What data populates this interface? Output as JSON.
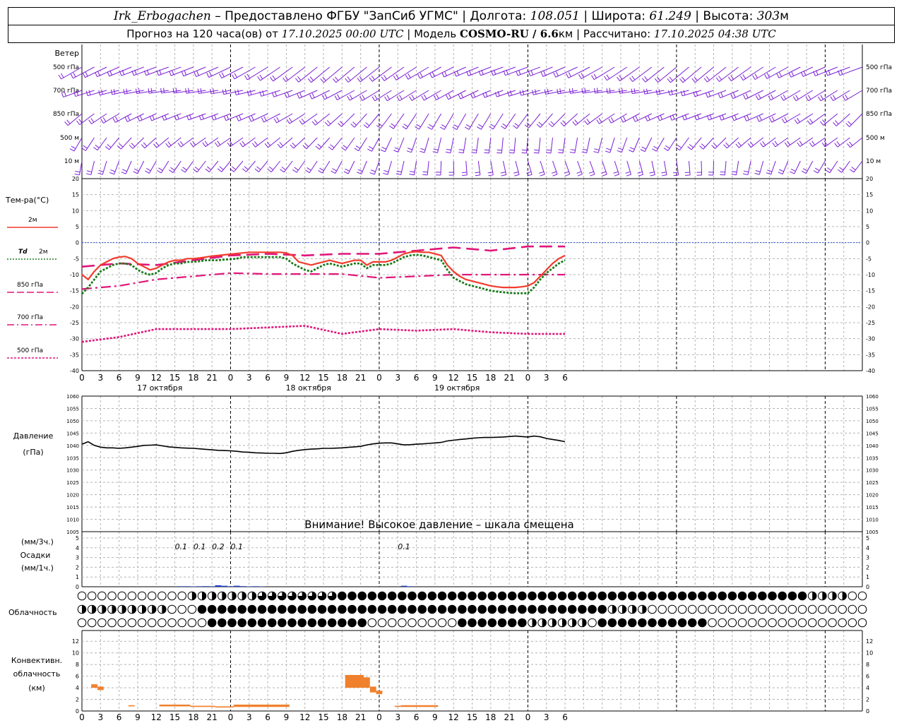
{
  "header": {
    "station": "Irk_Erbogachen",
    "provider": " – Предоставлено ФГБУ \"ЗапСиб УГМС\" | Долгота: ",
    "lon": "108.051",
    "lat_label": " | Широта: ",
    "lat": "61.249",
    "alt_label": " | Высота: ",
    "alt": "303",
    "alt_unit": "м",
    "forecast_label": "Прогноз на 120 часа(ов) от ",
    "forecast_time": "17.10.2025 00:00 UTC",
    "model_label": " | Модель ",
    "model": "COSMO-RU / 6.6",
    "model_unit": "км",
    "calc_label": " | Рассчитано: ",
    "calc_time": "17.10.2025 04:38 UTC"
  },
  "colors": {
    "wind": "#7b1fd6",
    "t2m": "#f03c2c",
    "td2m": "#1a7a1a",
    "t850": "#e0157a",
    "t700": "#e0157a",
    "t500": "#e0157a",
    "pressure": "#000000",
    "precip": "#1f3fcf",
    "convective": "#f0802c",
    "grid": "#b4b4b4",
    "zero_line": "#3050d0"
  },
  "time_axis": {
    "hour_labels": [
      "0",
      "3",
      "6",
      "9",
      "12",
      "15",
      "18",
      "21",
      "0",
      "3",
      "6",
      "9",
      "12",
      "15",
      "18",
      "21",
      "0",
      "3",
      "6",
      "9",
      "12",
      "15",
      "18",
      "21",
      "0",
      "3",
      "6"
    ],
    "days": [
      "17 октября",
      "18 октября",
      "19 октября"
    ]
  },
  "wind_panel": {
    "title": "Ветер",
    "levels": [
      "500 гПа",
      "700 гПа",
      "850 гПа",
      "500 м",
      "10 м"
    ],
    "icon": "wind-barb-icon"
  },
  "temp_panel": {
    "title": "Тем-ра(°С)",
    "legend": [
      {
        "label": "2м",
        "style": "solid"
      },
      {
        "label": "2м",
        "prefix": "Td",
        "style": "dotted"
      },
      {
        "label": "850 гПа",
        "style": "dash"
      },
      {
        "label": "700 гПа",
        "style": "dashdot"
      },
      {
        "label": "500 гПа",
        "style": "fine-dash"
      }
    ],
    "y_ticks": [
      "20",
      "15",
      "10",
      "5",
      "0",
      "-5",
      "-10",
      "-15",
      "-20",
      "-25",
      "-30",
      "-35",
      "-40"
    ]
  },
  "pressure_panel": {
    "title": "Давление",
    "unit": "(гПа)",
    "y_ticks": [
      "1060",
      "1055",
      "1050",
      "1045",
      "1040",
      "1035",
      "1030",
      "1025",
      "1020",
      "1015",
      "1010",
      "1005"
    ],
    "warning": "Внимание! Высокое давление – шкала смещена"
  },
  "precip_panel": {
    "unit3": "(мм/3ч.)",
    "title": "Осадки",
    "unit1": "(мм/1ч.)",
    "y_ticks": [
      "5",
      "4",
      "3",
      "2",
      "1",
      "0"
    ],
    "labels": [
      {
        "hour": 16,
        "text": "0.1"
      },
      {
        "hour": 19,
        "text": "0.1"
      },
      {
        "hour": 22,
        "text": "0.2"
      },
      {
        "hour": 25,
        "text": "0.1"
      },
      {
        "hour": 52,
        "text": "0.1"
      }
    ]
  },
  "cloud_panel": {
    "title": "Облачность",
    "icon": "cloud-cover-circle-icon"
  },
  "conv_panel": {
    "title1": "Конвективн.",
    "title2": "облачность",
    "unit": "(км)",
    "y_ticks": [
      "12",
      "10",
      "8",
      "6",
      "4",
      "2",
      "0"
    ]
  },
  "chart_data": [
    {
      "type": "line",
      "title": "Тем-ра(°С)",
      "x_unit": "hours since 17.10.2025 00 UTC",
      "ylim": [
        -40,
        20
      ],
      "series": [
        {
          "name": "2м",
          "x": [
            0,
            1,
            2,
            3,
            4,
            5,
            6,
            7,
            8,
            9,
            10,
            11,
            12,
            13,
            14,
            15,
            16,
            17,
            18,
            19,
            20,
            21,
            22,
            23,
            24,
            25,
            26,
            27,
            28,
            29,
            30,
            31,
            32,
            33,
            34,
            35,
            36,
            37,
            38,
            39,
            40,
            41,
            42,
            43,
            44,
            45,
            46,
            47,
            48,
            49,
            50,
            51,
            52,
            53,
            54,
            55,
            56,
            57,
            58,
            59,
            60,
            61,
            62,
            63,
            64,
            65,
            66,
            67,
            68,
            69,
            70,
            71,
            72,
            73,
            74,
            75,
            76,
            77,
            78
          ],
          "values": [
            -10,
            -11.5,
            -9,
            -7,
            -6,
            -5,
            -4.5,
            -4.3,
            -5,
            -6.5,
            -7.5,
            -8.5,
            -8,
            -7,
            -6,
            -5.5,
            -5.5,
            -5,
            -5,
            -4.8,
            -4.5,
            -4.2,
            -4,
            -3.8,
            -3.6,
            -3.4,
            -3.2,
            -3,
            -3,
            -3,
            -3,
            -3,
            -3,
            -3.2,
            -4,
            -6,
            -6.5,
            -7,
            -6.5,
            -6,
            -5.5,
            -6,
            -6.5,
            -6,
            -5.5,
            -5.5,
            -7,
            -6,
            -6,
            -6,
            -5.5,
            -4.5,
            -3.5,
            -3,
            -2.8,
            -3,
            -3,
            -3.5,
            -4,
            -7,
            -9,
            -10.5,
            -11.5,
            -12,
            -12.5,
            -13,
            -13.5,
            -13.8,
            -14,
            -14,
            -14,
            -13.8,
            -13.5,
            -12.5,
            -10.5,
            -8.5,
            -6.5,
            -5,
            -4
          ]
        },
        {
          "name": "Td 2м",
          "x": [
            0,
            1,
            2,
            3,
            4,
            5,
            6,
            7,
            8,
            9,
            10,
            11,
            12,
            13,
            14,
            15,
            16,
            17,
            18,
            19,
            20,
            21,
            22,
            23,
            24,
            25,
            26,
            27,
            28,
            29,
            30,
            31,
            32,
            33,
            34,
            35,
            36,
            37,
            38,
            39,
            40,
            41,
            42,
            43,
            44,
            45,
            46,
            47,
            48,
            49,
            50,
            51,
            52,
            53,
            54,
            55,
            56,
            57,
            58,
            59,
            60,
            61,
            62,
            63,
            64,
            65,
            66,
            67,
            68,
            69,
            70,
            71,
            72,
            73,
            74,
            75,
            76,
            77,
            78
          ],
          "values": [
            -16,
            -14,
            -11.5,
            -9,
            -8,
            -7,
            -6.5,
            -6.5,
            -7,
            -8.5,
            -9.5,
            -10,
            -9.5,
            -8,
            -7,
            -6.5,
            -6.5,
            -6,
            -6,
            -5.8,
            -5.5,
            -5.5,
            -5.5,
            -5.3,
            -5.2,
            -5,
            -4.5,
            -4.5,
            -4.5,
            -4.5,
            -4.5,
            -4.5,
            -4.5,
            -5,
            -6.5,
            -7.5,
            -8.5,
            -9,
            -8,
            -7,
            -6.5,
            -7,
            -7.5,
            -7,
            -6.5,
            -6.5,
            -8,
            -7,
            -7,
            -7,
            -6.5,
            -5.5,
            -4.5,
            -4,
            -3.8,
            -4,
            -4.5,
            -5,
            -5.5,
            -8.5,
            -11,
            -12,
            -13,
            -13.5,
            -14,
            -14.5,
            -15,
            -15.3,
            -15.5,
            -15.7,
            -15.8,
            -15.8,
            -15.8,
            -14,
            -11.5,
            -9.5,
            -8,
            -6.5,
            -5.5
          ]
        },
        {
          "name": "850 гПа",
          "x": [
            0,
            6,
            12,
            18,
            24,
            30,
            36,
            42,
            48,
            54,
            60,
            66,
            72,
            78
          ],
          "values": [
            -7.5,
            -6.5,
            -7,
            -5.5,
            -4,
            -3.5,
            -4,
            -3.5,
            -3.5,
            -2.5,
            -1.5,
            -2.5,
            -1.2,
            -1.2
          ]
        },
        {
          "name": "700 гПа",
          "x": [
            0,
            6,
            12,
            18,
            24,
            30,
            36,
            42,
            48,
            54,
            60,
            66,
            72,
            78
          ],
          "values": [
            -14.5,
            -13.5,
            -11.5,
            -10.5,
            -9.5,
            -9.8,
            -9.8,
            -9.8,
            -11,
            -10.5,
            -10,
            -10,
            -10,
            -10
          ]
        },
        {
          "name": "500 гПа",
          "x": [
            0,
            6,
            12,
            18,
            24,
            30,
            36,
            42,
            48,
            54,
            60,
            66,
            72,
            78
          ],
          "values": [
            -31,
            -29.5,
            -27,
            -27,
            -27,
            -26.5,
            -26,
            -28.5,
            -27,
            -27.5,
            -27,
            -28,
            -28.5,
            -28.5
          ]
        }
      ]
    },
    {
      "type": "line",
      "title": "Давление",
      "ylim": [
        1005,
        1060
      ],
      "series": [
        {
          "name": "Давление",
          "x": [
            0,
            1,
            2,
            3,
            4,
            5,
            6,
            7,
            8,
            9,
            10,
            11,
            12,
            13,
            14,
            15,
            16,
            17,
            18,
            19,
            20,
            21,
            22,
            23,
            24,
            25,
            26,
            27,
            28,
            29,
            30,
            31,
            32,
            33,
            34,
            35,
            36,
            37,
            38,
            39,
            40,
            41,
            42,
            43,
            44,
            45,
            46,
            47,
            48,
            49,
            50,
            51,
            52,
            53,
            54,
            55,
            56,
            57,
            58,
            59,
            60,
            61,
            62,
            63,
            64,
            65,
            66,
            67,
            68,
            69,
            70,
            71,
            72,
            73,
            74,
            75,
            76,
            77,
            78
          ],
          "values": [
            1040.5,
            1041.5,
            1040,
            1039.3,
            1039,
            1039,
            1038.8,
            1039,
            1039.3,
            1039.6,
            1040,
            1040.1,
            1040.2,
            1039.8,
            1039.4,
            1039.2,
            1039,
            1038.9,
            1038.8,
            1038.6,
            1038.4,
            1038.2,
            1038,
            1037.9,
            1037.8,
            1037.6,
            1037.3,
            1037.2,
            1037,
            1036.9,
            1036.8,
            1036.8,
            1036.7,
            1037,
            1037.6,
            1038,
            1038.3,
            1038.5,
            1038.6,
            1038.8,
            1038.8,
            1038.9,
            1039,
            1039.2,
            1039.4,
            1039.6,
            1040.2,
            1040.6,
            1040.9,
            1041,
            1041,
            1040.6,
            1040.2,
            1040.3,
            1040.5,
            1040.6,
            1040.8,
            1041,
            1041.2,
            1041.8,
            1042.1,
            1042.4,
            1042.6,
            1042.9,
            1043.1,
            1043.2,
            1043.2,
            1043.3,
            1043.4,
            1043.6,
            1043.8,
            1043.6,
            1043.4,
            1043.8,
            1043.5,
            1042.8,
            1042.4,
            1042,
            1041.5
          ]
        }
      ]
    },
    {
      "type": "bar",
      "title": "Осадки",
      "ylim": [
        0,
        5
      ],
      "series": [
        {
          "name": "Осадки",
          "x": [
            16,
            17,
            18,
            19,
            20,
            21,
            22,
            23,
            24,
            25,
            26,
            27,
            28,
            29,
            52,
            53
          ],
          "values": [
            0.05,
            0.05,
            0.03,
            0.05,
            0.06,
            0.05,
            0.15,
            0.1,
            0.05,
            0.1,
            0.06,
            0.03,
            0.05,
            0.03,
            0.1,
            0.05
          ]
        }
      ]
    },
    {
      "type": "bar",
      "title": "Конвективн. облачность",
      "ylim": [
        0,
        13
      ],
      "series": [
        {
          "name": "Конвективн. облачность",
          "segments": [
            {
              "x0": 1.5,
              "x1": 2.5,
              "lo": 4,
              "hi": 4.6
            },
            {
              "x0": 2.5,
              "x1": 3.5,
              "lo": 3.6,
              "hi": 4.2
            },
            {
              "x0": 7.5,
              "x1": 8.5,
              "lo": 0.8,
              "hi": 1
            },
            {
              "x0": 12.5,
              "x1": 17.5,
              "lo": 0.8,
              "hi": 1.1
            },
            {
              "x0": 17.5,
              "x1": 21.5,
              "lo": 0.7,
              "hi": 0.9
            },
            {
              "x0": 21.5,
              "x1": 24.5,
              "lo": 0.6,
              "hi": 0.8
            },
            {
              "x0": 24.5,
              "x1": 33.5,
              "lo": 0.7,
              "hi": 1.1
            },
            {
              "x0": 42.5,
              "x1": 45.5,
              "lo": 4,
              "hi": 6.2
            },
            {
              "x0": 45.5,
              "x1": 46.5,
              "lo": 4,
              "hi": 5.8
            },
            {
              "x0": 46.5,
              "x1": 47.5,
              "lo": 3.2,
              "hi": 4.2
            },
            {
              "x0": 47.5,
              "x1": 48.5,
              "lo": 2.9,
              "hi": 3.5
            },
            {
              "x0": 50.5,
              "x1": 51.5,
              "lo": 0.7,
              "hi": 0.9
            },
            {
              "x0": 51.5,
              "x1": 57.5,
              "lo": 0.7,
              "hi": 1
            }
          ]
        }
      ]
    }
  ]
}
